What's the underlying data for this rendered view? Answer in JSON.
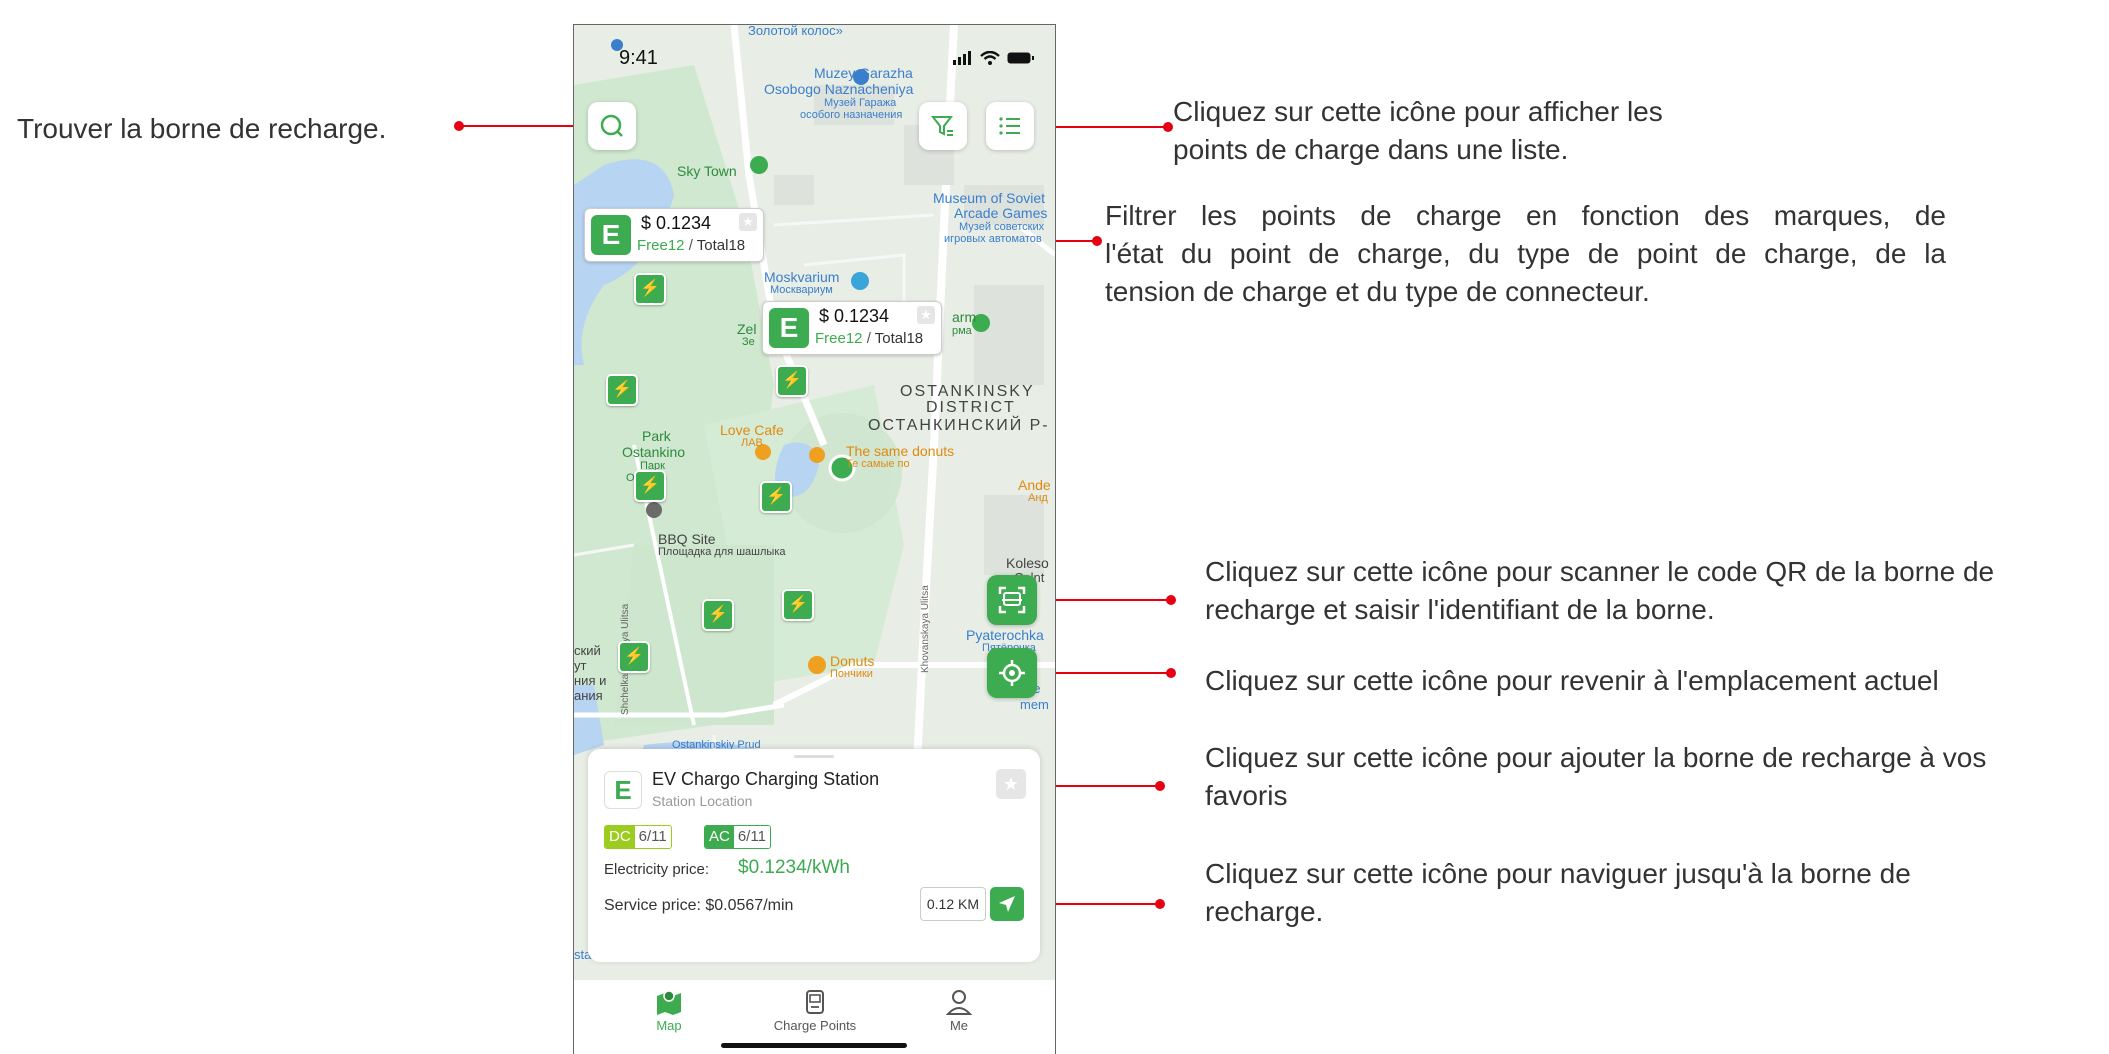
{
  "annotations": {
    "find": "Trouver la borne de recharge.",
    "list_line1": "Cliquez sur cette icône pour afficher les",
    "list_line2": "points de charge dans une liste.",
    "filter_line1": "Filtrer les points de charge en fonction des marques, de",
    "filter_line2": "l'état du point de charge, du type de point de charge, de la",
    "filter_line3": "tension de charge et du type de connecteur.",
    "scan_line1": "Cliquez sur cette icône pour scanner le code QR de la borne de",
    "scan_line2": "recharge et saisir l'identifiant de la borne.",
    "locate": "Cliquez sur cette icône pour revenir à l'emplacement actuel",
    "fav_line1": "Cliquez sur cette icône pour ajouter la borne de recharge à vos",
    "fav_line2": "favoris",
    "nav_line1": "Cliquez sur cette icône pour naviguer jusqu'à la borne de",
    "nav_line2": "recharge."
  },
  "status_bar": {
    "time": "9:41"
  },
  "map": {
    "labels": {
      "zolotoy": "Золотой колос»",
      "muzey1": "Muzey Garazha",
      "muzey2": "Osobogo Naznacheniya",
      "muzey3": "Музей Гаража",
      "muzey4": "особого назначения",
      "skytown": "Sky Town",
      "museum_soviet1": "Museum of Soviet",
      "museum_soviet2": "Arcade Games",
      "museum_soviet3": "Музей советских",
      "museum_soviet4": "игровых автоматов",
      "moskvarium1": "Moskvarium",
      "moskvarium2": "Москвариум",
      "zel": "Zel",
      "ze": "Зе",
      "arm": "arm",
      "rma": "рма",
      "ostankinsky1": "OSTANKINSKY",
      "ostankinsky2": "DISTRICT",
      "ostankinsky3": "ОСТАНКИНСКИЙ Р-",
      "park1": "Park",
      "park2": "Ostankino",
      "park3": "Парк",
      "park4": "Оста",
      "lovecafe1": "Love Cafe",
      "lovecafe2": "ЛАВ",
      "samedonuts1": "The same donuts",
      "samedonuts2": "Те самые по",
      "ande1": "Ande",
      "ande2": "Анд",
      "bbq1": "BBQ Site",
      "bbq2": "Площадка для шашлыка",
      "koleso1": "Koleso",
      "koleso2": "Colnt",
      "pyaterochka1": "Pyaterochka",
      "pyaterochka2": "Пятёрочка",
      "donuts1": "Donuts",
      "donuts2": "Пончики",
      "me1": "ие",
      "me2": "mem",
      "shchelk": "Shchelkanovskaya Ulitsa",
      "khovan": "Khovanskaya Ulitsa",
      "leftcut1": "ский",
      "leftcut2": "ут",
      "leftcut3": "ния и",
      "leftcut4": "ания",
      "prud": "Ostankinskiy Prud",
      "farm": "stankino State Farm"
    },
    "price_cards": [
      {
        "price": "$ 0.1234",
        "free": "Free12",
        "slash": "/",
        "total": "Total18"
      },
      {
        "price": "$ 0.1234",
        "free": "Free12",
        "slash": "/",
        "total": "Total18"
      }
    ]
  },
  "station": {
    "name": "EV Chargo Charging Station",
    "location": "Station Location",
    "dc_label": "DC",
    "dc_value": "6/11",
    "ac_label": "AC",
    "ac_value": "6/11",
    "electricity_label": "Electricity price:",
    "electricity_value": "$0.1234/kWh",
    "service_label": "Service price: $0.0567/min",
    "distance": "0.12 KM"
  },
  "tabs": [
    {
      "label": "Map",
      "icon": "map-icon",
      "active": true
    },
    {
      "label": "Charge Points",
      "icon": "charge-point-icon",
      "active": false
    },
    {
      "label": "Me",
      "icon": "person-icon",
      "active": false
    }
  ],
  "colors": {
    "accent": "#3dab4f",
    "annotation_line": "#e60012",
    "dc_badge": "#9ccc1f",
    "ac_badge": "#3dab4f"
  }
}
